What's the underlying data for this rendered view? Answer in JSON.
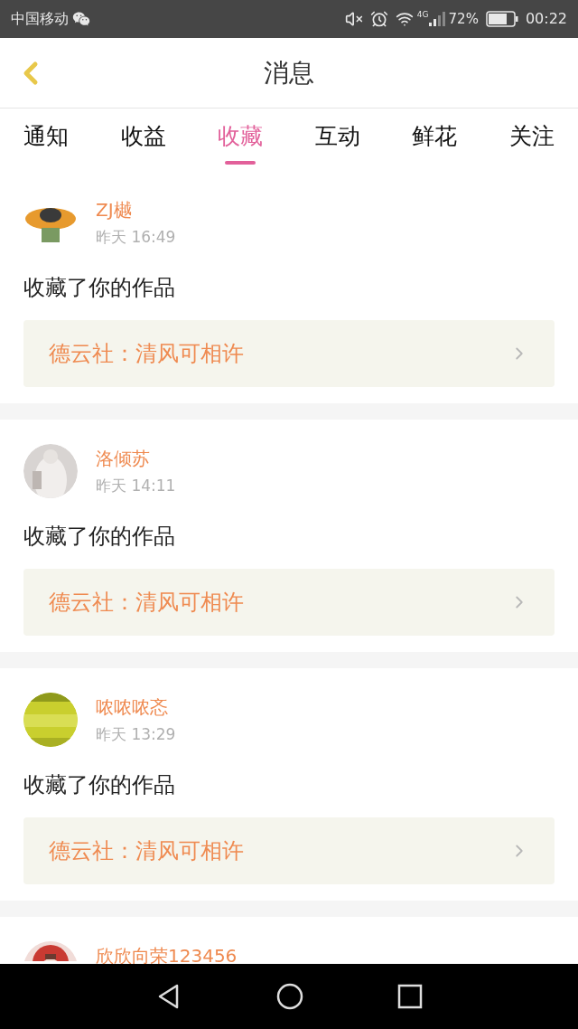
{
  "status_bar": {
    "carrier": "中国移动",
    "network": "4G",
    "battery": "72%",
    "time": "00:22"
  },
  "header": {
    "title": "消息"
  },
  "tabs": [
    {
      "label": "通知",
      "selected": false
    },
    {
      "label": "收益",
      "selected": false
    },
    {
      "label": "收藏",
      "selected": true
    },
    {
      "label": "互动",
      "selected": false
    },
    {
      "label": "鲜花",
      "selected": false
    },
    {
      "label": "关注",
      "selected": false
    }
  ],
  "messages": [
    {
      "name": "ZJ樾",
      "time": "昨天 16:49",
      "action": "收藏了你的作品",
      "work": "德云社：清风可相许"
    },
    {
      "name": "洛倾苏",
      "time": "昨天 14:11",
      "action": "收藏了你的作品",
      "work": "德云社：清风可相许"
    },
    {
      "name": "哝哝哝忞",
      "time": "昨天 13:29",
      "action": "收藏了你的作品",
      "work": "德云社：清风可相许"
    },
    {
      "name": "欣欣向荣123456"
    }
  ]
}
